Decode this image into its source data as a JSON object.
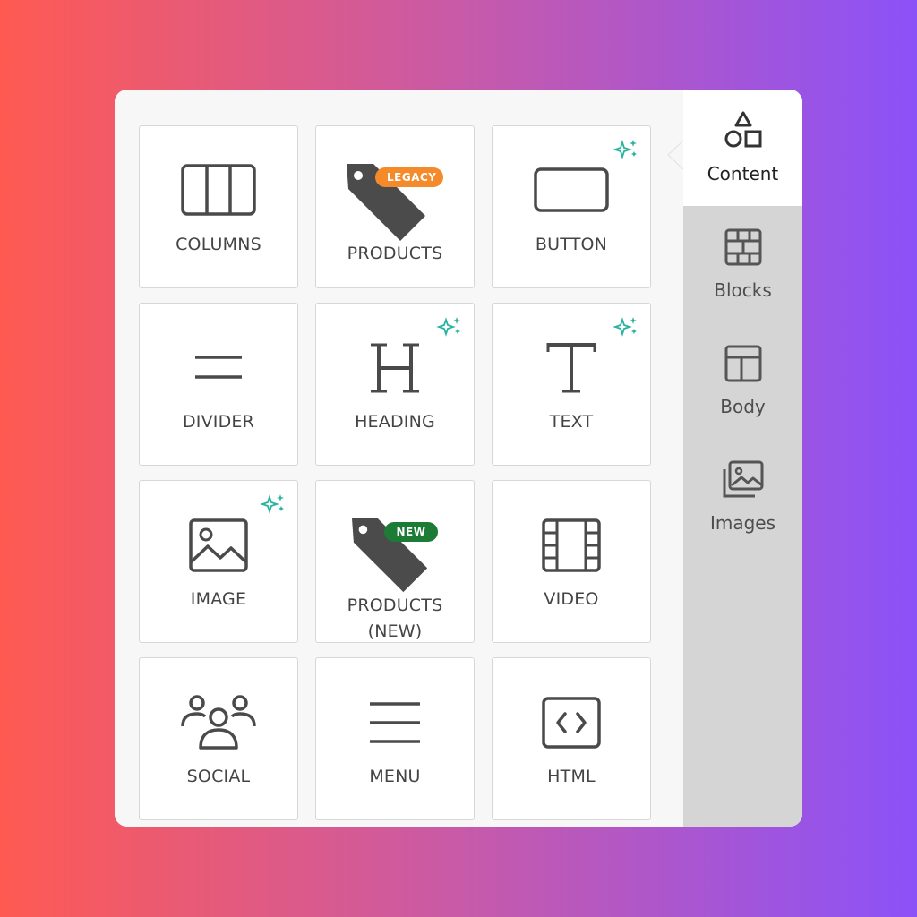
{
  "panel": {
    "tools": [
      {
        "id": "columns",
        "label": "COLUMNS",
        "icon": "columns-icon"
      },
      {
        "id": "products-legacy",
        "label": "PRODUCTS",
        "icon": "tag-icon",
        "badge": "LEGACY"
      },
      {
        "id": "button",
        "label": "BUTTON",
        "icon": "button-icon",
        "ai": true
      },
      {
        "id": "divider",
        "label": "DIVIDER",
        "icon": "divider-icon"
      },
      {
        "id": "heading",
        "label": "HEADING",
        "icon": "heading-icon",
        "ai": true
      },
      {
        "id": "text",
        "label": "TEXT",
        "icon": "text-icon",
        "ai": true
      },
      {
        "id": "image",
        "label": "IMAGE",
        "icon": "image-icon",
        "ai": true
      },
      {
        "id": "products-new",
        "label_line1": "PRODUCTS",
        "label_line2": "(NEW)",
        "icon": "tag-icon",
        "badge": "NEW"
      },
      {
        "id": "video",
        "label": "VIDEO",
        "icon": "video-icon"
      },
      {
        "id": "social",
        "label": "SOCIAL",
        "icon": "social-icon"
      },
      {
        "id": "menu",
        "label": "MENU",
        "icon": "menu-icon"
      },
      {
        "id": "html",
        "label": "HTML",
        "icon": "html-icon"
      }
    ]
  },
  "sidebar": {
    "items": [
      {
        "label": "Content",
        "icon": "shapes-icon",
        "active": true
      },
      {
        "label": "Blocks",
        "icon": "blocks-icon"
      },
      {
        "label": "Body",
        "icon": "body-layout-icon"
      },
      {
        "label": "Images",
        "icon": "images-icon"
      }
    ]
  },
  "colors": {
    "legacy_badge": "#f58a2a",
    "new_badge": "#1c7b34",
    "ai_sparkle": "#2ab3a0",
    "icon_stroke": "#4a4a4a"
  }
}
